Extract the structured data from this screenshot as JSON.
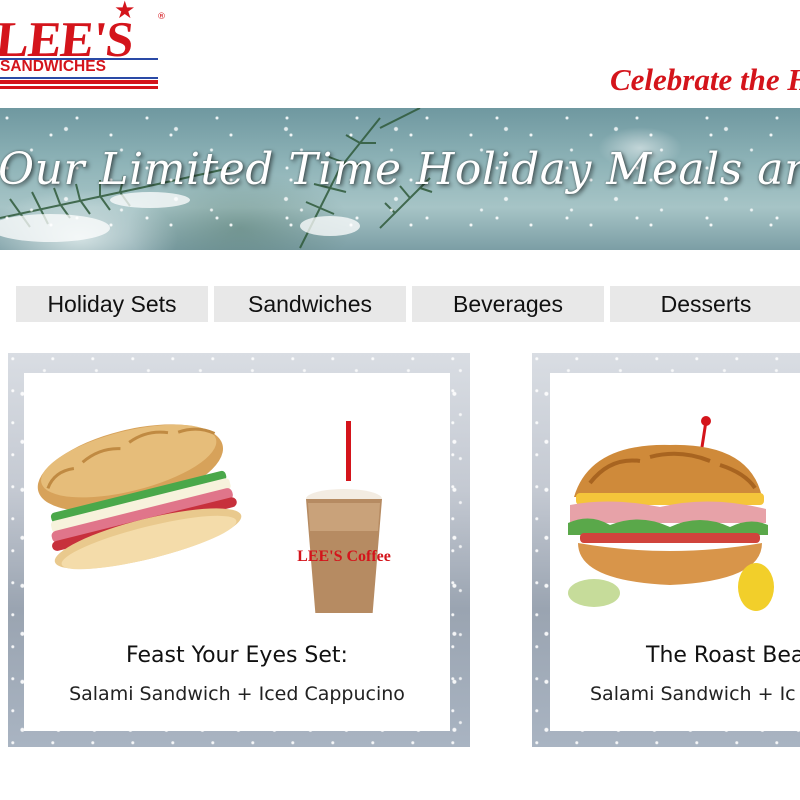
{
  "header": {
    "logo_word": "LEE'S",
    "logo_sub": "SANDWICHES",
    "logo_reg": "®",
    "promo_text": "Celebrate the H"
  },
  "banner": {
    "headline": "Our Limited Time Holiday Meals are h"
  },
  "tabs": [
    {
      "label": "Holiday Sets"
    },
    {
      "label": "Sandwiches"
    },
    {
      "label": "Beverages"
    },
    {
      "label": "Desserts"
    }
  ],
  "cards": [
    {
      "title": "Feast Your Eyes Set:",
      "subtitle": "Salami Sandwich + Iced Cappucino",
      "cup_text": "LEE'S Coffee"
    },
    {
      "title": "The Roast Bea",
      "subtitle": "Salami Sandwich + Ic"
    }
  ],
  "colors": {
    "brand_red": "#d4141b",
    "brand_blue": "#2a4aa6",
    "tab_bg": "#e8e8e8"
  }
}
